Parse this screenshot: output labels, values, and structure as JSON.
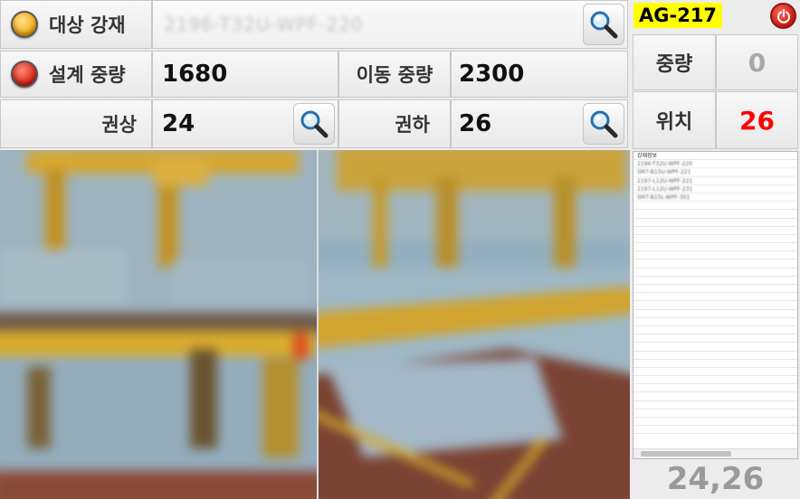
{
  "target_steel": {
    "label": "대상 강재",
    "value": "2196-T32U-WPF-220",
    "lamp_color": "#f0a810"
  },
  "design_weight": {
    "label": "설계 중량",
    "value": "1680",
    "lamp_color": "#d42010"
  },
  "move_weight": {
    "label": "이동 중량",
    "value": "2300"
  },
  "upper_range": {
    "label": "권상",
    "value": "24"
  },
  "lower_range": {
    "label": "권하",
    "value": "26"
  },
  "side_panel": {
    "crane_id": "AG-217",
    "weight_label": "중량",
    "weight_value": "0",
    "position_label": "위치",
    "position_value": "26",
    "position_color": "#ff0000",
    "info_title": "강재정보",
    "info_items": [
      "2196-T32U-WPF-220",
      "SM7-B15U-WPF-221",
      "2197-L12U-WPF-221",
      "2197-L12U-WPF-231",
      "SM7-B15L-WPF-301"
    ],
    "coordinates": "24,26"
  },
  "icons": {
    "search": "search-icon",
    "power": "power-icon",
    "lamp": "status-lamp-icon"
  }
}
